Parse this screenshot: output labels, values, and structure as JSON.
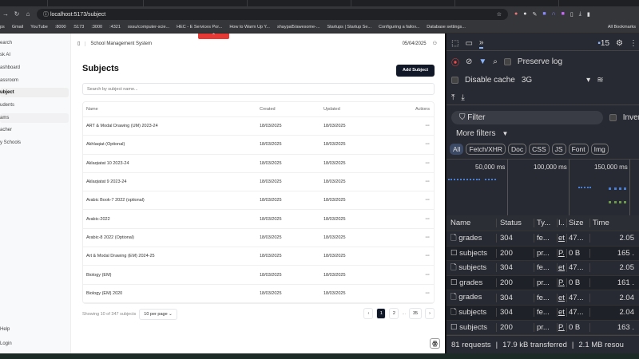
{
  "browser": {
    "url": "localhost:5173/subject",
    "bookmarks": [
      "ps",
      "Gmail",
      "YouTube",
      ":8000",
      ":5173",
      ":3000",
      ":4321",
      "ossu/computer-scie...",
      "HEC - E Services Por...",
      "How to Warm Up Y...",
      "shaypal5/awesome-...",
      "Startups | Startup Se...",
      "Configuring a failov...",
      "Database settings...",
      "All Bookmarks"
    ]
  },
  "sidebar": {
    "items": [
      {
        "label": "earch"
      },
      {
        "label": "sk AI"
      },
      {
        "label": "ashboard"
      },
      {
        "label": "assroom"
      },
      {
        "label": "ubject"
      },
      {
        "label": "udents"
      },
      {
        "label": "ams"
      },
      {
        "label": "acher"
      },
      {
        "label": "y Schools"
      }
    ],
    "bottom": [
      {
        "label": "Help"
      },
      {
        "label": "Login"
      }
    ]
  },
  "header": {
    "app_title": "School Management System",
    "date": "05/04/2025"
  },
  "page": {
    "title": "Subjects",
    "add_label": "Add Subject",
    "search_placeholder": "Search by subject name...",
    "columns": [
      "Name",
      "Created",
      "Updated",
      "Actions"
    ],
    "rows": [
      {
        "name": "ART & Modal Drawing (UM) 2023-24",
        "created": "18/03/2025",
        "updated": "18/03/2025"
      },
      {
        "name": "Akhlaqiat (Optional)",
        "created": "18/03/2025",
        "updated": "18/03/2025"
      },
      {
        "name": "Aklaqiatat 10 2023-24",
        "created": "18/03/2025",
        "updated": "18/03/2025"
      },
      {
        "name": "Aklaqiatat 9 2023-24",
        "created": "18/03/2025",
        "updated": "18/03/2025"
      },
      {
        "name": "Arabic Book-7 2022 (optional)",
        "created": "18/03/2025",
        "updated": "18/03/2025"
      },
      {
        "name": "Arabic-2022",
        "created": "18/03/2025",
        "updated": "18/03/2025"
      },
      {
        "name": "Arabic-8 2022 (Optional)",
        "created": "18/03/2025",
        "updated": "18/03/2025"
      },
      {
        "name": "Art & Modal Drawing (EM) 2024-25",
        "created": "18/03/2025",
        "updated": "18/03/2025"
      },
      {
        "name": "Biology (EM)",
        "created": "18/03/2025",
        "updated": "18/03/2025"
      },
      {
        "name": "Biology (EM) 2020",
        "created": "18/03/2025",
        "updated": "18/03/2025"
      }
    ],
    "actions_label": "···",
    "showing": "Showing 10 of 347 subjects",
    "per_page": "10 per page",
    "pages": [
      "1",
      "2",
      "...",
      "35"
    ],
    "current_page": "1"
  },
  "devtools": {
    "issues": "15",
    "preserve_log": "Preserve log",
    "disable_cache": "Disable cache",
    "throttle": "3G",
    "filter_placeholder": "Filter",
    "invert": "Inver",
    "more_filters": "More filters",
    "chips": [
      "All",
      "Fetch/XHR",
      "Doc",
      "CSS",
      "JS",
      "Font",
      "Img"
    ],
    "timeline": [
      "50,000 ms",
      "100,000 ms",
      "150,000 ms"
    ],
    "columns": [
      "Name",
      "Status",
      "Ty...",
      "I..",
      "Size",
      "Time"
    ],
    "requests": [
      {
        "name": "grades",
        "status": "304",
        "type": "fe...",
        "init": "et",
        "size": "47...",
        "time": "2.05"
      },
      {
        "name": "subjects",
        "status": "200",
        "type": "pr...",
        "init": "P.",
        "size": "0 B",
        "time": "165 ."
      },
      {
        "name": "subjects",
        "status": "304",
        "type": "fe...",
        "init": "et",
        "size": "47...",
        "time": "2.05"
      },
      {
        "name": "grades",
        "status": "200",
        "type": "pr...",
        "init": "P.",
        "size": "0 B",
        "time": "161 ."
      },
      {
        "name": "grades",
        "status": "304",
        "type": "fe...",
        "init": "et",
        "size": "47...",
        "time": "2.04"
      },
      {
        "name": "subjects",
        "status": "304",
        "type": "fe...",
        "init": "et",
        "size": "47...",
        "time": "2.04"
      },
      {
        "name": "subjects",
        "status": "200",
        "type": "pr...",
        "init": "P.",
        "size": "0 B",
        "time": "163 ."
      }
    ],
    "summary": [
      "81 requests",
      "17.9 kB transferred",
      "2.1 MB resou"
    ]
  }
}
